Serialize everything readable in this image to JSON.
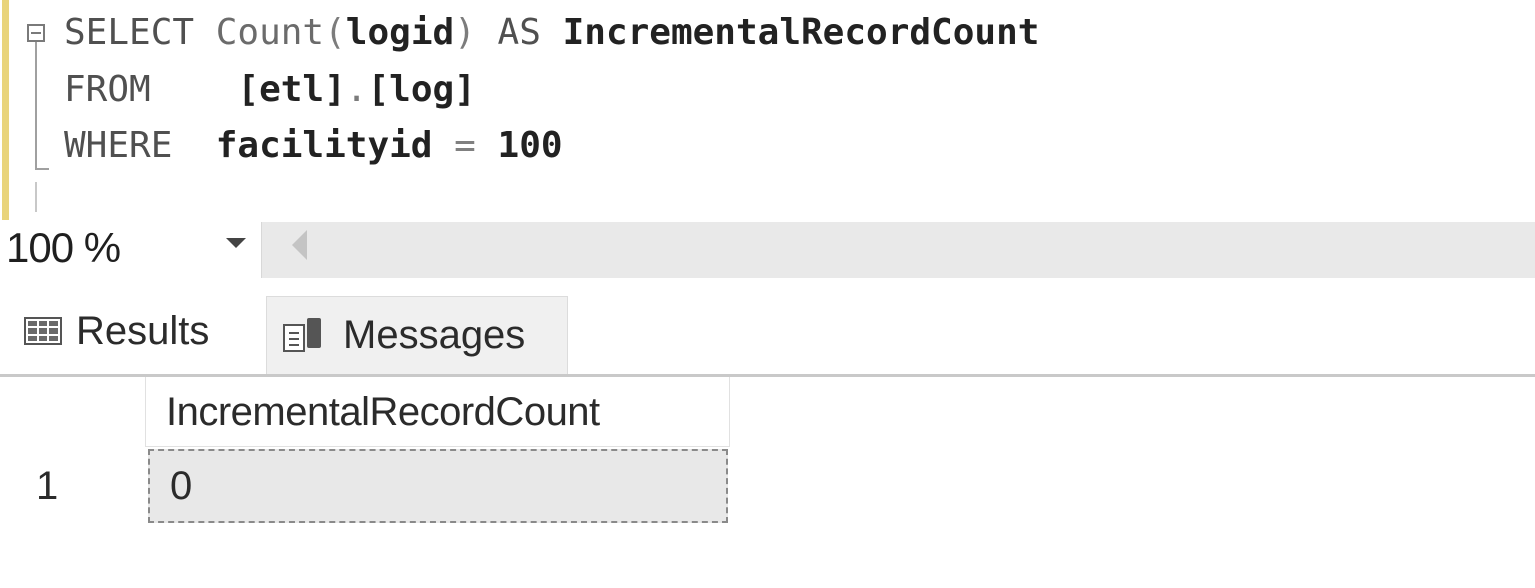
{
  "editor": {
    "line1": {
      "keyword": "SELECT",
      "function": "Count",
      "open": "(",
      "arg": "logid",
      "close": ")",
      "as": "AS",
      "alias": "IncrementalRecordCount"
    },
    "line2": {
      "keyword": "FROM",
      "schema": "[etl]",
      "dot": ".",
      "table": "[log]"
    },
    "line3": {
      "keyword": "WHERE",
      "column": "facilityid",
      "op": "=",
      "value": "100"
    }
  },
  "zoom": {
    "value": "100 %"
  },
  "tabs": {
    "results_label": "Results",
    "messages_label": "Messages",
    "active": "Results"
  },
  "results": {
    "columns": [
      "IncrementalRecordCount"
    ],
    "rows": [
      {
        "rownum": "1",
        "values": [
          "0"
        ]
      }
    ]
  },
  "colors": {
    "change_bar": "#e9d47c",
    "selected_cell": "#e8e8e8",
    "strip": "#e9e9e9"
  },
  "icons": {
    "outline": "collapse-minus-icon",
    "zoom": "dropdown-caret-icon",
    "scroll": "scroll-left-icon",
    "results": "grid-icon",
    "messages": "messages-icon"
  }
}
